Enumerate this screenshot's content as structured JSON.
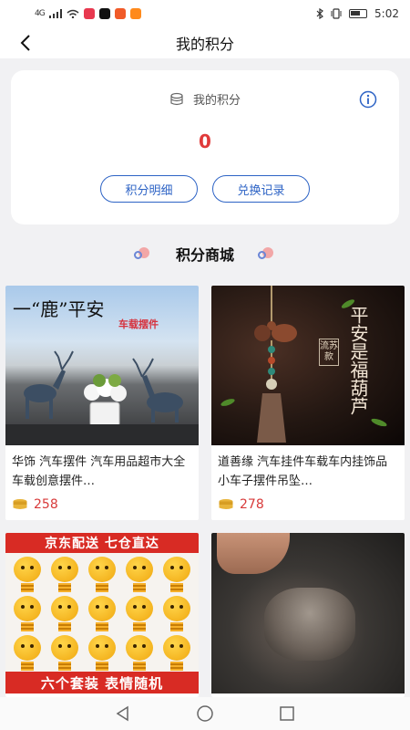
{
  "status_bar": {
    "signal": "4G",
    "time": "5:02"
  },
  "header": {
    "title": "我的积分"
  },
  "points_card": {
    "label": "我的积分",
    "value": "0",
    "detail_button": "积分明细",
    "exchange_button": "兑换记录"
  },
  "mall": {
    "title": "积分商城",
    "products": [
      {
        "title": "华饰 汽车摆件 汽车用品超市大全车载创意摆件…",
        "price": "258",
        "image_text": [
          "一“鹿”平安",
          "车载摆件"
        ]
      },
      {
        "title": "道善缘 汽车挂件车载车内挂饰品小车子摆件吊坠…",
        "price": "278",
        "image_text": [
          "平安是福葫芦",
          "流苏款"
        ]
      },
      {
        "title": "",
        "price": "",
        "image_text": [
          "京东配送 七仓直达",
          "六个套装 表情随机"
        ]
      },
      {
        "title": "",
        "price": "",
        "image_text": []
      }
    ]
  },
  "colors": {
    "accent_blue": "#2d63c5",
    "points_red": "#e03a3a",
    "price_red": "#d83a3a",
    "background": "#f1f1f3"
  }
}
